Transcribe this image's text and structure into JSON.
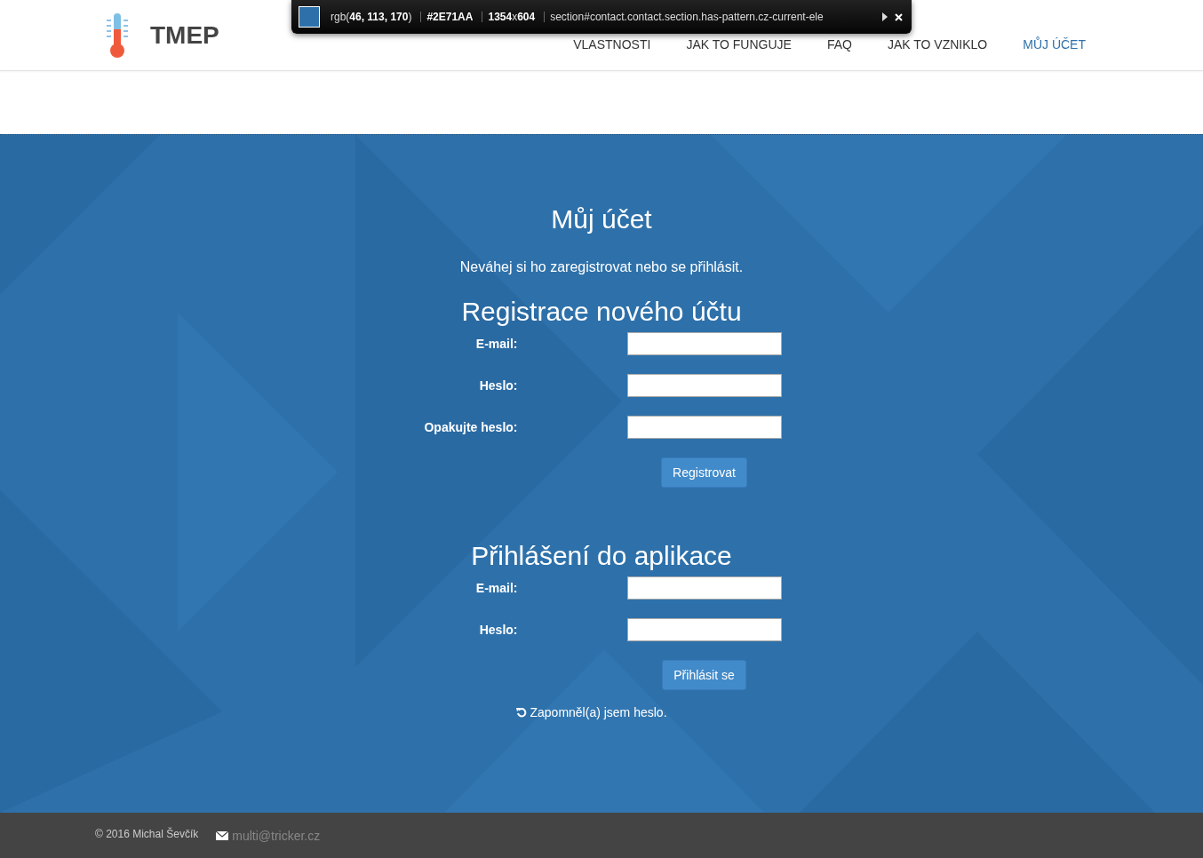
{
  "header": {
    "logo": "TMEP",
    "nav": [
      {
        "label": "VLASTNOSTI",
        "selected": false
      },
      {
        "label": "JAK TO FUNGUJE",
        "selected": false
      },
      {
        "label": "FAQ",
        "selected": false
      },
      {
        "label": "JAK TO VZNIKLO",
        "selected": false
      },
      {
        "label": "MŮJ ÚČET",
        "selected": true
      }
    ]
  },
  "inspector_tooltip": {
    "color": "#2e71aa",
    "rgb_prefix": "rgb(",
    "rgb_values": "46, 113, 170",
    "rgb_suffix": ")",
    "hex": "#2E71AA",
    "size_w": "1354",
    "size_x": "x",
    "size_h": "604",
    "selector": "section#contact.contact.section.has-pattern.cz-current-ele"
  },
  "section": {
    "title": "Můj účet",
    "subtitle": "Neváhej si ho zaregistrovat nebo se přihlásit.",
    "forms": [
      {
        "title": "Registrace nového účtu",
        "fields": [
          {
            "label": "E-mail:"
          },
          {
            "label": "Heslo:"
          },
          {
            "label": "Opakujte heslo:"
          }
        ],
        "button": "Registrovat"
      },
      {
        "title": "Přihlášení do aplikace",
        "fields": [
          {
            "label": "E-mail:"
          },
          {
            "label": "Heslo:"
          }
        ],
        "button": "Přihlásit se",
        "link": "Zapomněl(a) jsem heslo."
      }
    ]
  },
  "footer": {
    "copyright": "© 2016 Michal Ševčík",
    "email": "multi@tricker.cz"
  }
}
